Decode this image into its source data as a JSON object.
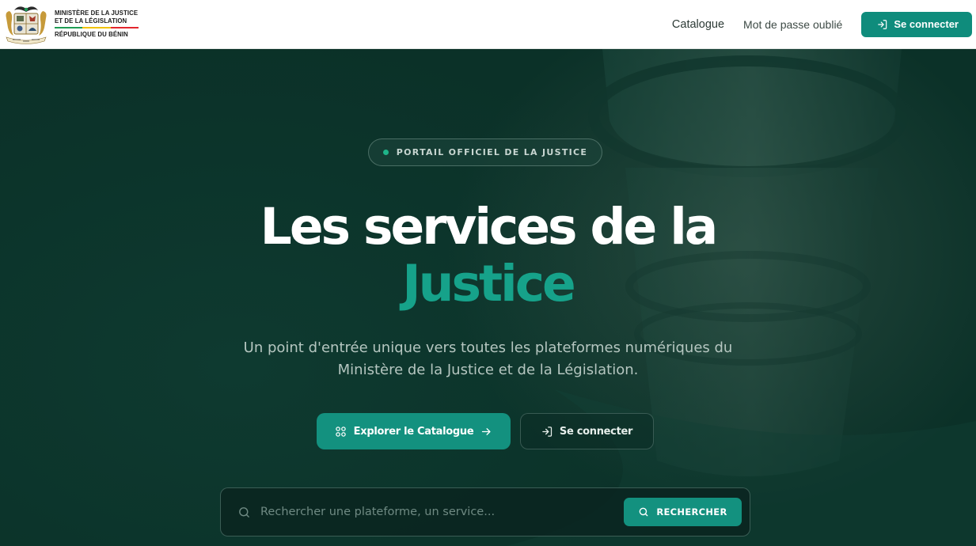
{
  "header": {
    "logo": {
      "icon": "benin-coat-of-arms",
      "line1": "MINISTÈRE DE LA JUSTICE",
      "line2": "ET DE LA LÉGISLATION",
      "line3": "RÉPUBLIQUE DU BÉNIN",
      "flag_colors": [
        "#1f9d55",
        "#f2c300",
        "#e3262d"
      ]
    },
    "nav": {
      "catalogue": "Catalogue",
      "forgot_password": "Mot de passe oublié",
      "login_button": "Se connecter",
      "login_icon": "login-icon"
    }
  },
  "hero": {
    "badge": "PORTAIL OFFICIEL DE LA JUSTICE",
    "title_line1": "Les services de la",
    "title_line2": "Justice",
    "subtitle_line1": "Un point d'entrée unique vers toutes les plateformes numériques du",
    "subtitle_line2": "Ministère de la Justice et de la Législation.",
    "cta_primary": "Explorer le Catalogue",
    "cta_secondary": "Se connecter"
  },
  "search": {
    "placeholder": "Rechercher une plateforme, un service...",
    "value": "",
    "button": "RECHERCHER"
  },
  "colors": {
    "accent": "#13917f",
    "accent_text": "#16a28a",
    "background": "#0c342b"
  }
}
